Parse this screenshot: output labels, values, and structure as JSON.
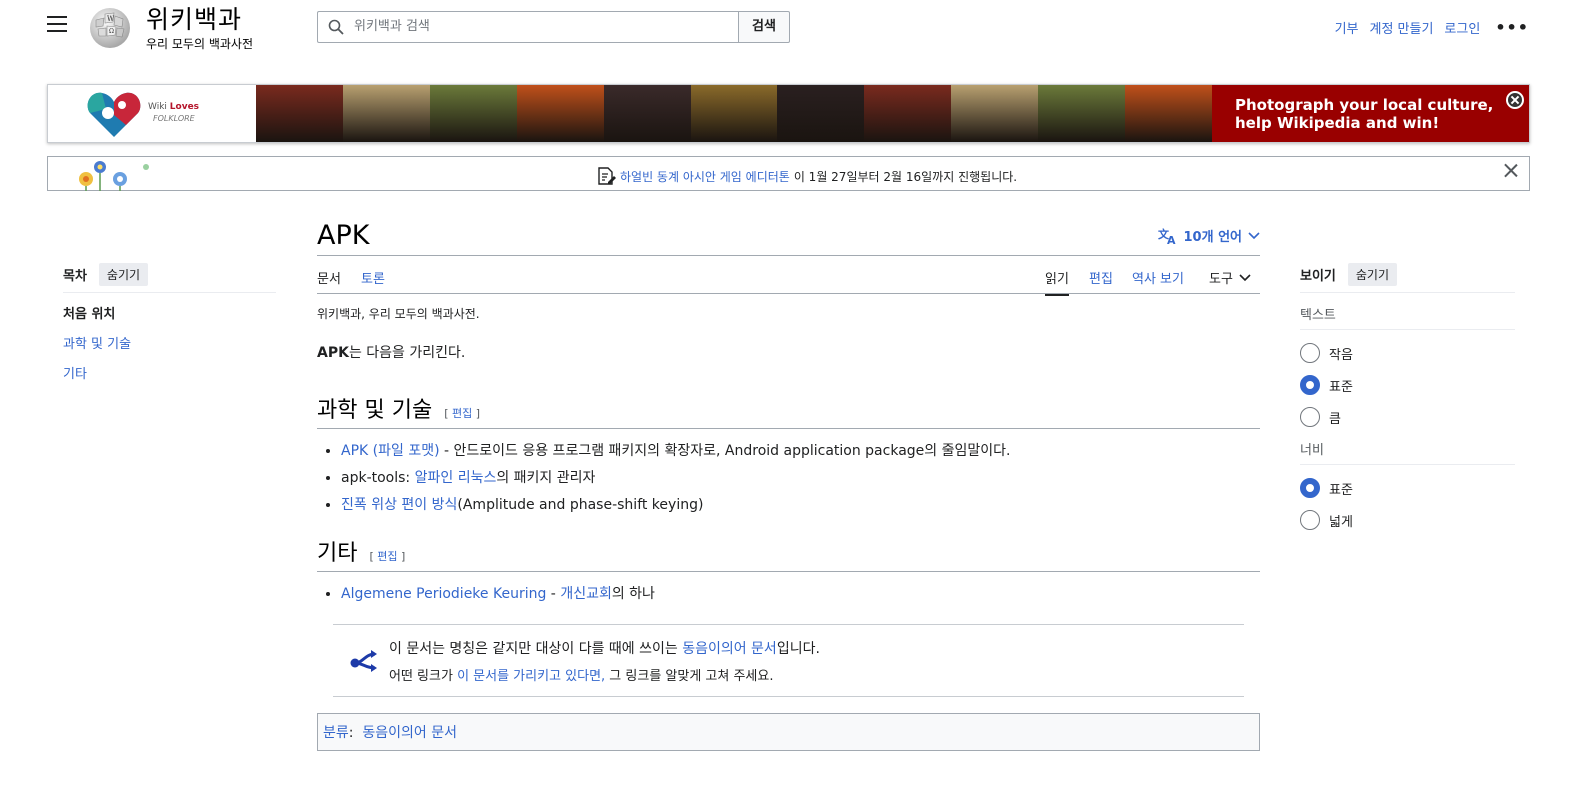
{
  "header": {
    "wordmark": "위키백과",
    "tagline": "우리 모두의 백과사전",
    "search_placeholder": "위키백과 검색",
    "search_button": "검색",
    "user_links": [
      "기부",
      "계정 만들기",
      "로그인"
    ],
    "more": "•••"
  },
  "banner": {
    "logo_line1_a": "Wiki",
    "logo_line1_b": "Loves",
    "logo_line2": "FOLKLORE",
    "cta_line1": "Photograph your local culture,",
    "cta_line2": "help Wikipedia and win!",
    "photo_colors": [
      "#7a2a1e",
      "#b8a070",
      "#6b7a3a",
      "#c0501a",
      "#3a2a2a",
      "#8a6a2a",
      "#2a2020",
      "#7a2a1e",
      "#b8a070",
      "#6b7a3a",
      "#c0501a"
    ]
  },
  "notice": {
    "link_text": "하얼빈 동계 아시안 게임 에디터톤",
    "text": "이 1월 27일부터 2월 16일까지 진행됩니다."
  },
  "toc": {
    "title": "목차",
    "hide": "숨기기",
    "items": [
      "처음 위치",
      "과학 및 기술",
      "기타"
    ]
  },
  "article": {
    "title": "APK",
    "languages": "10개 언어",
    "tabs_left": [
      "문서",
      "토론"
    ],
    "tabs_right": [
      "읽기",
      "편집",
      "역사 보기",
      "도구"
    ],
    "site_sub": "위키백과, 우리 모두의 백과사전.",
    "intro_bold": "APK",
    "intro_rest": "는 다음을 가리킨다.",
    "sections": [
      {
        "heading": "과학 및 기술",
        "edit_open": "[ ",
        "edit": "편집",
        "edit_close": " ]",
        "items": [
          {
            "link": "APK (파일 포맷)",
            "text": " - 안드로이드 응용 프로그램 패키지의 확장자로, Android application package의 줄임말이다."
          },
          {
            "pre": "apk-tools: ",
            "link": "알파인 리눅스",
            "text": "의 패키지 관리자"
          },
          {
            "link": "진폭 위상 편이 방식",
            "text": "(Amplitude and phase-shift keying)"
          }
        ]
      },
      {
        "heading": "기타",
        "edit_open": "[ ",
        "edit": "편집",
        "edit_close": " ]",
        "items": [
          {
            "link": "Algemene Periodieke Keuring",
            "text": " - ",
            "link2": "개신교회",
            "text2": "의 하나"
          }
        ]
      }
    ],
    "hatnote": {
      "l1_pre": "이 문서는 명칭은 같지만 대상이 다를 때에 쓰이는 ",
      "l1_link": "동음이의어 문서",
      "l1_post": "입니다.",
      "l2_pre": "어떤 링크가 ",
      "l2_link": "이 문서를 가리키고 있다면,",
      "l2_post": " 그 링크를 알맞게 고쳐 주세요."
    },
    "categories_label": "분류",
    "categories_sep": ":",
    "categories": [
      "동음이의어 문서"
    ]
  },
  "appearance": {
    "title": "보이기",
    "hide": "숨기기",
    "text_label": "텍스트",
    "text_options": [
      "작음",
      "표준",
      "큼"
    ],
    "text_selected": "표준",
    "width_label": "너비",
    "width_options": [
      "표준",
      "넓게"
    ],
    "width_selected": "표준"
  },
  "colors": {
    "link": "#3366cc",
    "banner_red": "#990000"
  }
}
